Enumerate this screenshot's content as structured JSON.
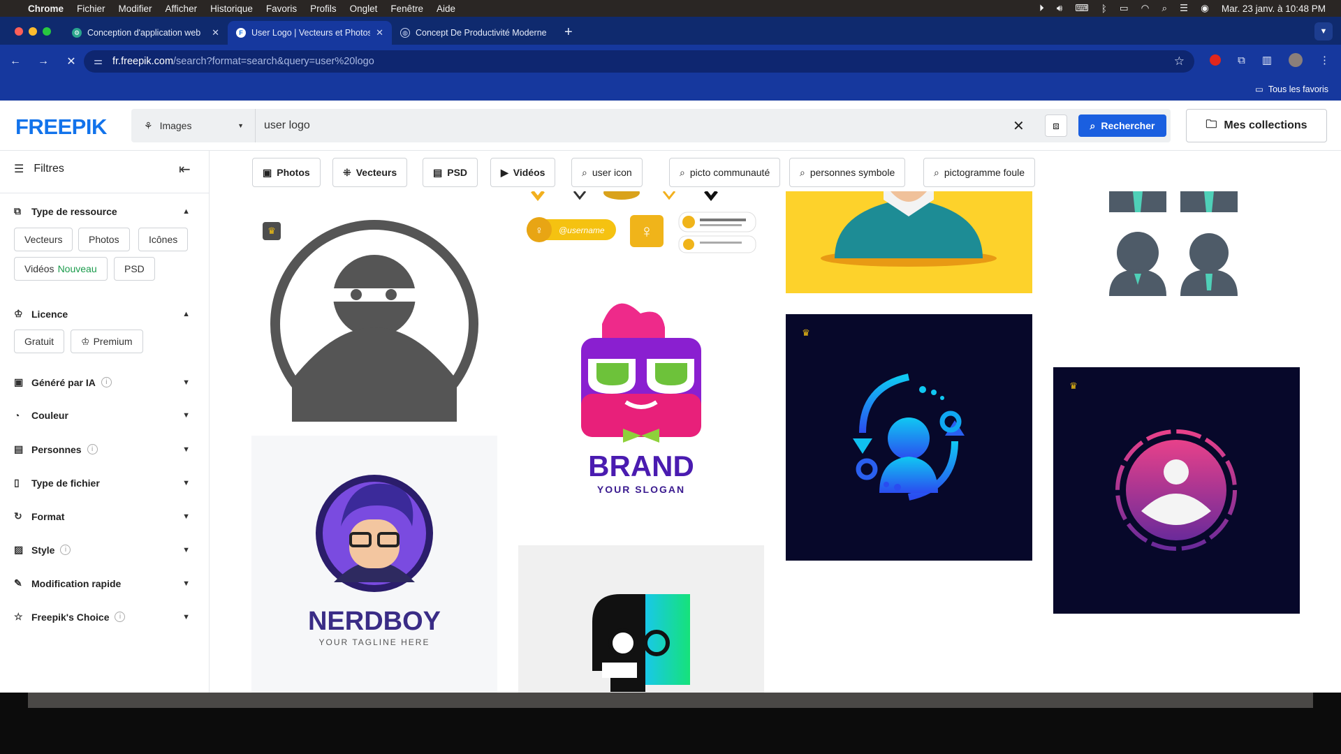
{
  "menubar": {
    "app": "Chrome",
    "items": [
      "Fichier",
      "Modifier",
      "Afficher",
      "Historique",
      "Favoris",
      "Profils",
      "Onglet",
      "Fenêtre",
      "Aide"
    ],
    "datetime": "Mar. 23 janv. à  10:48 PM"
  },
  "tabs": [
    {
      "title": "Conception d'application web",
      "active": false
    },
    {
      "title": "User Logo | Vecteurs et Photos",
      "active": true
    },
    {
      "title": "Concept De Productivité Moderne",
      "active": false
    }
  ],
  "address": {
    "host": "fr.freepik.com",
    "path": "/search?format=search&query=user%20logo"
  },
  "bookmarks": {
    "all_favorites": "Tous les favoris"
  },
  "header": {
    "logo": "FREEPIK",
    "resource_type": "Images",
    "query": "user logo",
    "search_button": "Rechercher",
    "collections": "Mes collections"
  },
  "sidebar": {
    "title": "Filtres",
    "resource_type": {
      "label": "Type de ressource",
      "chips": [
        "Vecteurs",
        "Photos",
        "Icônes",
        "Vidéos",
        "PSD"
      ],
      "new_badge": "Nouveau"
    },
    "license": {
      "label": "Licence",
      "chips": [
        "Gratuit",
        "Premium"
      ]
    },
    "sections": [
      "Généré par IA",
      "Couleur",
      "Personnes",
      "Type de fichier",
      "Format",
      "Style",
      "Modification rapide",
      "Freepik's Choice"
    ]
  },
  "filter_chips": [
    "Photos",
    "Vecteurs",
    "PSD",
    "Vidéos",
    "user icon",
    "picto communauté",
    "personnes symbole",
    "pictogramme foule"
  ],
  "cards": {
    "okru_username": "@username",
    "brand_title": "BRAND",
    "brand_slogan": "YOUR SLOGAN",
    "nerd_title": "NERDBOY",
    "nerd_tagline": "YOUR TAGLINE HERE"
  },
  "colors": {
    "freepik_blue": "#1273eb",
    "search_button": "#1a5fe0",
    "chrome_tab_bar": "#0f2a6e",
    "chrome_toolbar": "#16389e",
    "new_green": "#1a9b4b"
  }
}
